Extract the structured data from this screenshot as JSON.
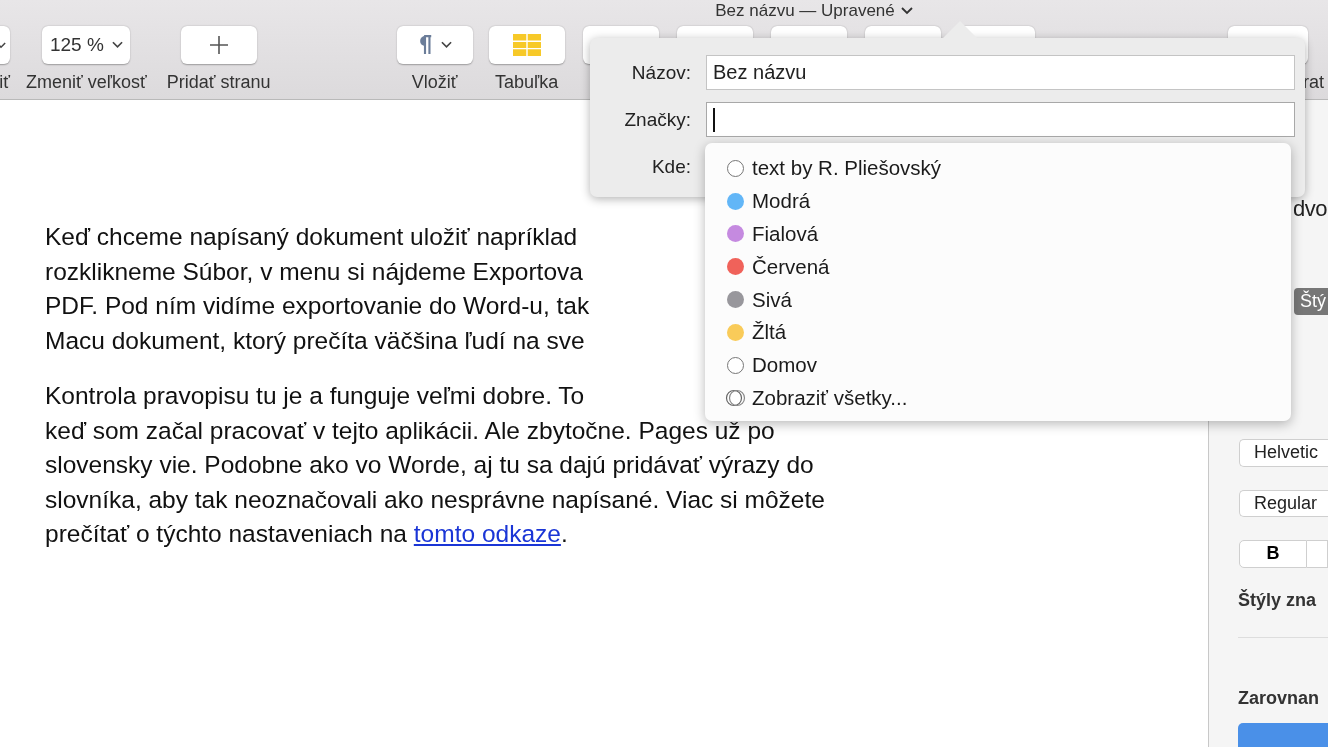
{
  "window": {
    "title": "Bez názvu — Upravené"
  },
  "toolbar": [
    {
      "kind": "partial",
      "label": "iť"
    },
    {
      "kind": "dropdown",
      "value": "125 %",
      "label": "Zmeniť veľkosť"
    },
    {
      "kind": "add",
      "label": "Pridať stranu"
    },
    {
      "kind": "insert",
      "label": "Vložiť"
    },
    {
      "kind": "table",
      "label": "Tabuľka"
    },
    {
      "kind": "hidden"
    },
    {
      "kind": "hidden"
    },
    {
      "kind": "hidden"
    },
    {
      "kind": "hidden"
    },
    {
      "kind": "hidden"
    },
    {
      "kind": "end",
      "label": "rat"
    }
  ],
  "document": {
    "paragraphs": [
      {
        "lines": [
          {
            "text": "Keď chceme napísaný dokument uložiť napríklad"
          },
          {
            "text": "rozklikneme Súbor, v menu si nájdeme Exportova"
          },
          {
            "text": "PDF. Pod ním vidíme exportovanie do Word-u, tak"
          },
          {
            "text": "Macu dokument, ktorý prečíta väčšina ľudí na sve"
          }
        ]
      },
      {
        "lines": [
          {
            "text": "Kontrola pravopisu tu je a funguje veľmi dobre. To"
          },
          {
            "text": "keď som začal pracovať v tejto aplikácii. Ale zbytočne. Pages už po"
          },
          {
            "text": "slovensky vie. Podobne ako vo Worde, aj tu sa dajú pridávať výrazy do"
          },
          {
            "text": "slovníka, aby tak neoznačovali ako nesprávne napísané. Viac si môžete"
          },
          {
            "text": "prečítať o týchto nastaveniach na",
            "link": "tomto odkaze",
            "after": "."
          }
        ]
      }
    ]
  },
  "popover": {
    "fields": [
      {
        "label": "Názov:",
        "value": "Bez názvu",
        "focused": false
      },
      {
        "label": "Značky:",
        "focused": true
      }
    ],
    "location_label": "Kde:",
    "tags": [
      {
        "kind": "hollow",
        "label": "text by R. Pliešovský"
      },
      {
        "kind": "color",
        "label": "Modrá",
        "color": "#62b6f7"
      },
      {
        "kind": "color",
        "label": "Fialová",
        "color": "#c58ae0"
      },
      {
        "kind": "color",
        "label": "Červená",
        "color": "#f0625a"
      },
      {
        "kind": "color",
        "label": "Sivá",
        "color": "#98979c"
      },
      {
        "kind": "color",
        "label": "Žltá",
        "color": "#f9cb59"
      },
      {
        "kind": "hollow",
        "label": "Domov"
      },
      {
        "kind": "all",
        "label": "Zobraziť všetky..."
      }
    ]
  },
  "sidebar": {
    "heading": "dvo",
    "segment": {
      "label": "Štý",
      "selected": true
    },
    "font_family": "Helvetic",
    "font_style": "Regular",
    "bold": "B",
    "char_styles": "Štýly zna",
    "alignment": "Zarovnan"
  }
}
